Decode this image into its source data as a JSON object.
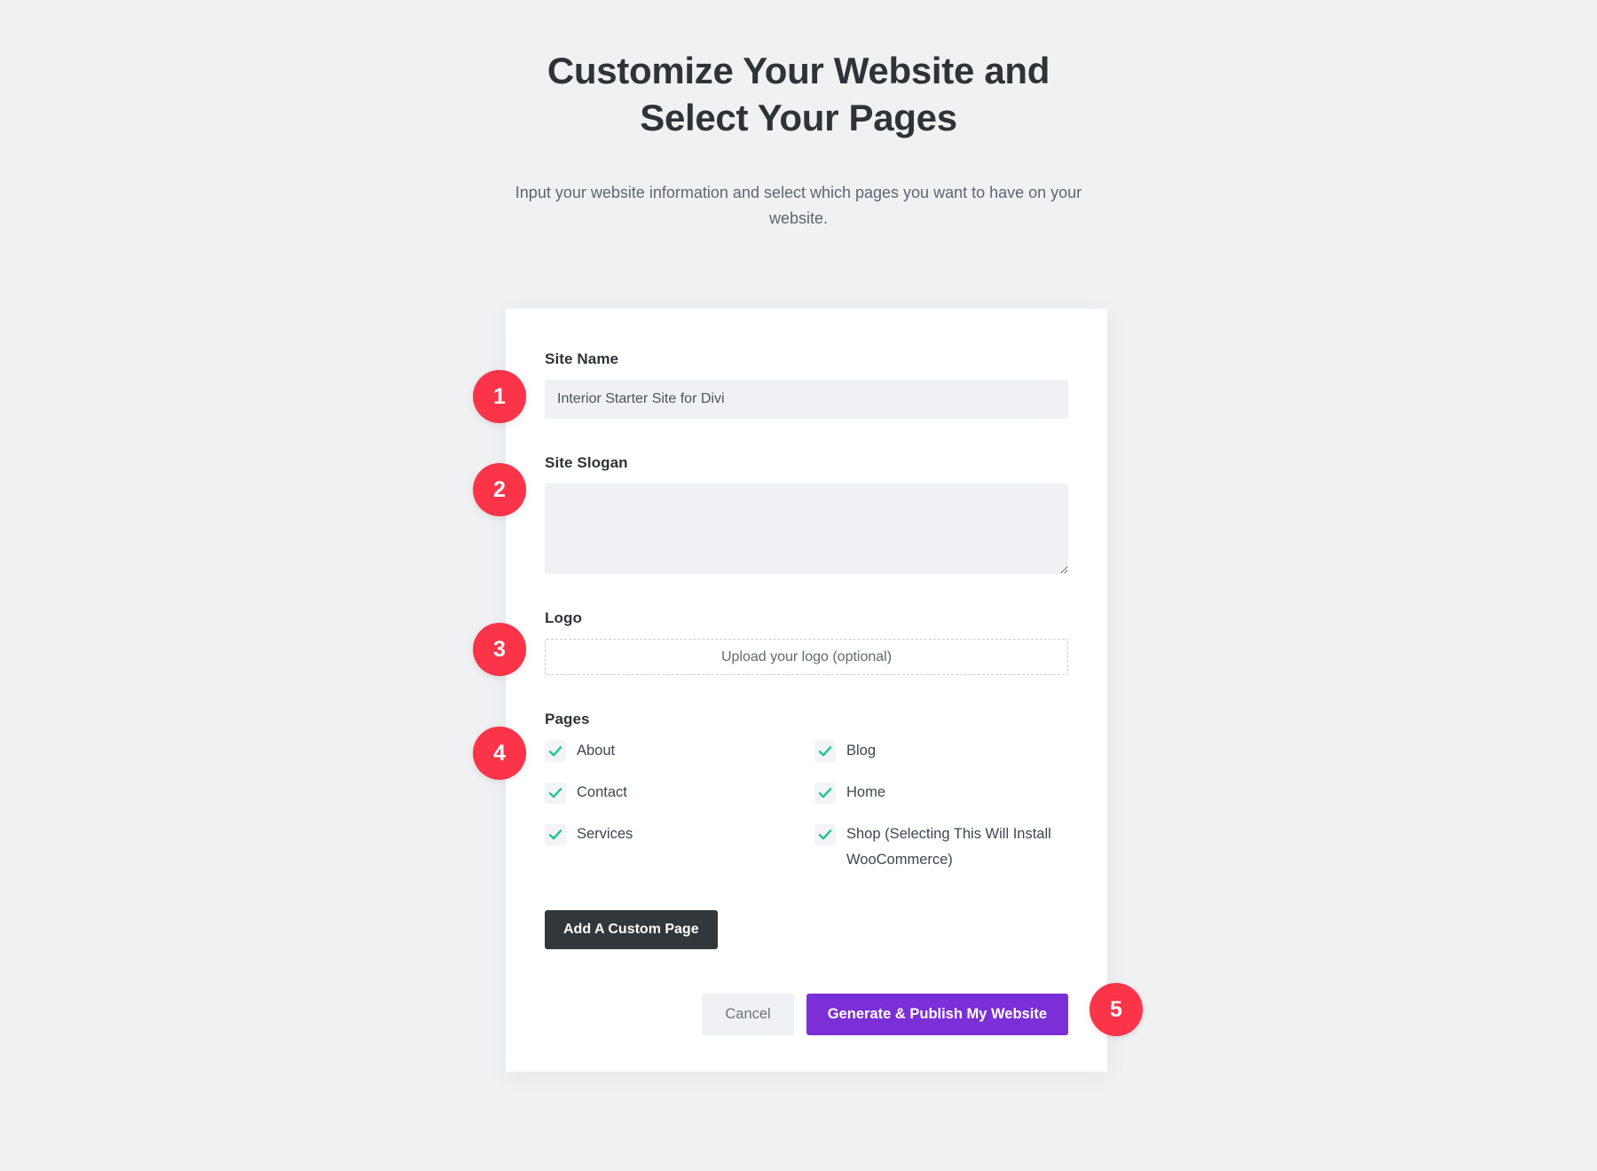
{
  "header": {
    "title": "Customize Your Website and Select Your Pages",
    "subtitle": "Input your website information and select which pages you want to have on your website."
  },
  "form": {
    "site_name": {
      "label": "Site Name",
      "value": "Interior Starter Site for Divi",
      "placeholder": ""
    },
    "site_slogan": {
      "label": "Site Slogan",
      "value": "",
      "placeholder": ""
    },
    "logo": {
      "label": "Logo",
      "upload_text": "Upload your logo (optional)"
    },
    "pages": {
      "label": "Pages",
      "items": [
        {
          "label": "About",
          "checked": true
        },
        {
          "label": "Blog",
          "checked": true
        },
        {
          "label": "Contact",
          "checked": true
        },
        {
          "label": "Home",
          "checked": true
        },
        {
          "label": "Services",
          "checked": true
        },
        {
          "label": "Shop (Selecting This Will Install WooCommerce)",
          "checked": true
        }
      ]
    },
    "add_custom_page_label": "Add A Custom Page"
  },
  "actions": {
    "cancel_label": "Cancel",
    "publish_label": "Generate & Publish My Website"
  },
  "badges": [
    {
      "number": "1"
    },
    {
      "number": "2"
    },
    {
      "number": "3"
    },
    {
      "number": "4"
    },
    {
      "number": "5"
    }
  ],
  "colors": {
    "badge_red": "#fb3449",
    "publish_purple": "#7b2fd6",
    "custom_page_dark": "#32373c",
    "check_green": "#1ec48f",
    "page_background": "#f0f1f3",
    "input_background": "#eff1f5"
  }
}
